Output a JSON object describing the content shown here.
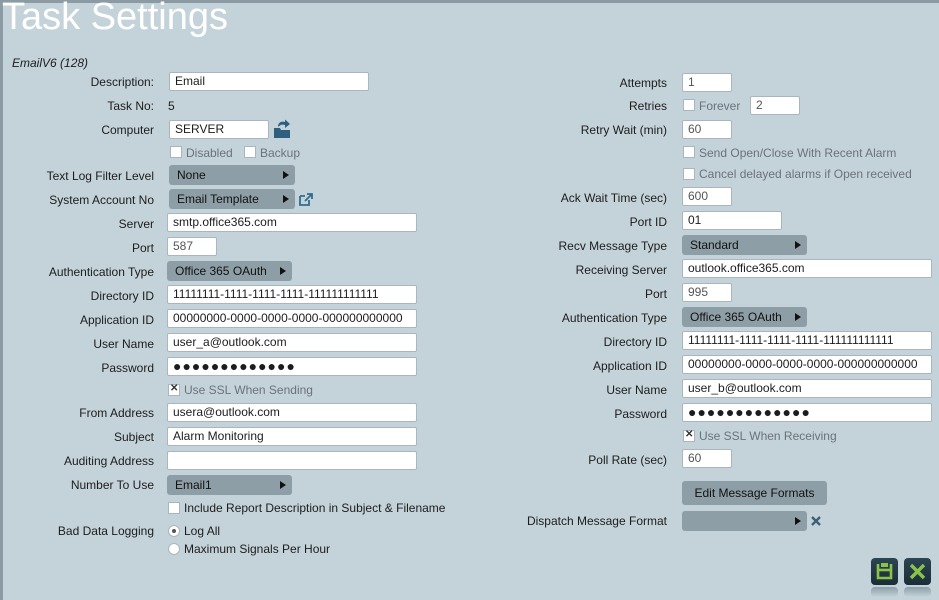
{
  "title": "Task Settings",
  "task_type": "EmailV6 (128)",
  "colors": {
    "background": "#c4d3da",
    "dropdown": "#8e9ea6",
    "icon_dark": "#1f3642",
    "icon_accent": "#8bc34a",
    "link_icon": "#2f6d8f"
  },
  "left": {
    "description": {
      "label": "Description:",
      "value": "Email"
    },
    "task_no": {
      "label": "Task No:",
      "value": "5"
    },
    "computer": {
      "label": "Computer",
      "value": "SERVER",
      "icon": "folder-arrow-icon"
    },
    "disabled": {
      "label": "Disabled",
      "checked": false
    },
    "backup": {
      "label": "Backup",
      "checked": false
    },
    "text_log_filter": {
      "label": "Text Log Filter Level",
      "value": "None"
    },
    "system_account": {
      "label": "System Account No",
      "value": "Email Template",
      "icon": "external-link-icon"
    },
    "server": {
      "label": "Server",
      "value": "smtp.office365.com"
    },
    "port": {
      "label": "Port",
      "value": "587"
    },
    "auth_type": {
      "label": "Authentication Type",
      "value": "Office 365 OAuth"
    },
    "directory_id": {
      "label": "Directory ID",
      "value": "11111111-1111-1111-1111-111111111111"
    },
    "application_id": {
      "label": "Application ID",
      "value": "00000000-0000-0000-0000-000000000000"
    },
    "user_name": {
      "label": "User Name",
      "value": "user_a@outlook.com"
    },
    "password": {
      "label": "Password",
      "value": "●●●●●●●●●●●●●"
    },
    "use_ssl": {
      "label": "Use SSL When Sending",
      "checked": true
    },
    "from_address": {
      "label": "From Address",
      "value": "usera@outlook.com"
    },
    "subject": {
      "label": "Subject",
      "value": "Alarm Monitoring"
    },
    "auditing_address": {
      "label": "Auditing Address",
      "value": ""
    },
    "number_to_use": {
      "label": "Number To Use",
      "value": "Email1"
    },
    "include_report": {
      "label": "Include Report Description in Subject & Filename",
      "checked": false
    },
    "bad_data_logging": {
      "label": "Bad Data Logging",
      "options": [
        {
          "label": "Log All",
          "selected": true
        },
        {
          "label": "Maximum Signals Per Hour",
          "selected": false
        }
      ]
    }
  },
  "right": {
    "attempts": {
      "label": "Attempts",
      "value": "1"
    },
    "retries": {
      "label": "Retries",
      "forever_label": "Forever",
      "forever_checked": false,
      "value": "2"
    },
    "retry_wait": {
      "label": "Retry Wait (min)",
      "value": "60"
    },
    "send_open_close": {
      "label": "Send Open/Close With Recent Alarm",
      "checked": false
    },
    "cancel_delayed": {
      "label": "Cancel delayed alarms if Open received",
      "checked": false
    },
    "ack_wait": {
      "label": "Ack Wait Time (sec)",
      "value": "600"
    },
    "port_id": {
      "label": "Port ID",
      "value": "01"
    },
    "recv_msg_type": {
      "label": "Recv Message Type",
      "value": "Standard"
    },
    "receiving_server": {
      "label": "Receiving Server",
      "value": "outlook.office365.com"
    },
    "port": {
      "label": "Port",
      "value": "995"
    },
    "auth_type": {
      "label": "Authentication Type",
      "value": "Office 365 OAuth"
    },
    "directory_id": {
      "label": "Directory ID",
      "value": "11111111-1111-1111-1111-111111111111"
    },
    "application_id": {
      "label": "Application ID",
      "value": "00000000-0000-0000-0000-000000000000"
    },
    "user_name": {
      "label": "User Name",
      "value": "user_b@outlook.com"
    },
    "password": {
      "label": "Password",
      "value": "●●●●●●●●●●●●●"
    },
    "use_ssl": {
      "label": "Use SSL When Receiving",
      "checked": true
    },
    "poll_rate": {
      "label": "Poll Rate (sec)",
      "value": "60"
    },
    "edit_formats_button": "Edit Message Formats",
    "dispatch_format": {
      "label": "Dispatch Message Format",
      "value": ""
    }
  },
  "footer": {
    "save_icon": "save-icon",
    "cancel_icon": "close-icon"
  }
}
